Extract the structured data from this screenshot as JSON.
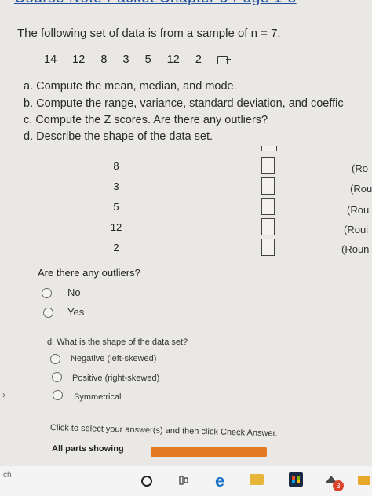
{
  "header": {
    "title": "Course Note Packet Chapter 3 Page 1-3"
  },
  "problem": {
    "statement": "The following set of data is from a sample of n = 7.",
    "data": [
      "14",
      "12",
      "8",
      "3",
      "5",
      "12",
      "2"
    ]
  },
  "questions": {
    "a": "a. Compute the mean, median, and mode.",
    "b": "b. Compute the range, variance, standard deviation, and coeffic",
    "c": "c. Compute the Z scores. Are there any outliers?",
    "d": "d. Describe the shape of the data set."
  },
  "zscore_table": {
    "values": [
      "8",
      "3",
      "5",
      "12",
      "2"
    ],
    "round_labels": [
      "(Ro",
      "(Rou",
      "(Rou",
      "(Roui",
      "(Roun"
    ]
  },
  "outliers": {
    "question": "Are there any outliers?",
    "options": [
      "No",
      "Yes"
    ]
  },
  "shape": {
    "question": "d. What is the shape of the data set?",
    "options": [
      "Negative (left-skewed)",
      "Positive (right-skewed)",
      "Symmetrical"
    ]
  },
  "footer": {
    "instruction": "Click to select your answer(s) and then click Check Answer.",
    "all_parts": "All parts showing",
    "progress_fraction": 1.0
  },
  "taskbar": {
    "search_text": "ch",
    "icons": [
      "start-circle-icon",
      "task-view-icon",
      "edge-browser-icon",
      "file-explorer-icon",
      "store-icon",
      "network-icon",
      "mail-icon"
    ],
    "badge": "3",
    "accent": "#e27a22"
  }
}
